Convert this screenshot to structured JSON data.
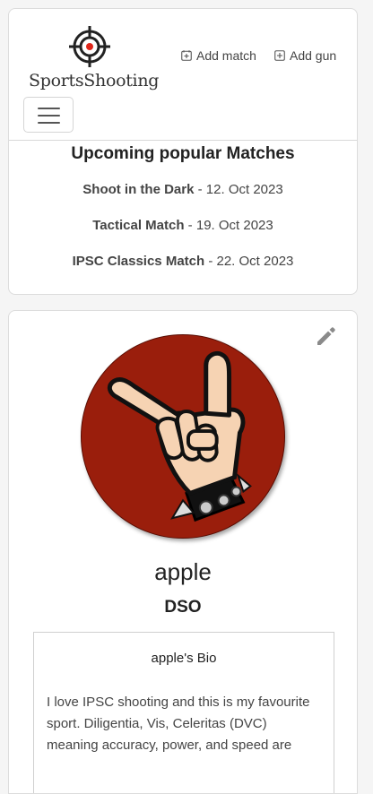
{
  "brand": {
    "name": "SportsShooting",
    "accent_color": "#e0261a"
  },
  "nav": {
    "add_match_label": "Add match",
    "add_gun_label": "Add gun",
    "add_icon": "plus-square-icon",
    "menu_icon": "hamburger-icon"
  },
  "upcoming": {
    "title": "Upcoming popular Matches",
    "matches": [
      {
        "name": "Shoot in the Dark",
        "date": " - 12. Oct 2023"
      },
      {
        "name": "Tactical Match",
        "date": " - 19. Oct 2023"
      },
      {
        "name": "IPSC Classics Match",
        "date": " - 22. Oct 2023"
      }
    ]
  },
  "profile": {
    "edit_icon": "pencil-icon",
    "avatar_icon": "rock-hand-icon",
    "avatar_bg_color": "#9a1e0c",
    "username": "apple",
    "role": "DSO",
    "bio_title": "apple's Bio",
    "bio_text": "I love IPSC shooting and this is my favourite sport. Diligentia, Vis, Celeritas (DVC) meaning accuracy, power, and speed are"
  }
}
